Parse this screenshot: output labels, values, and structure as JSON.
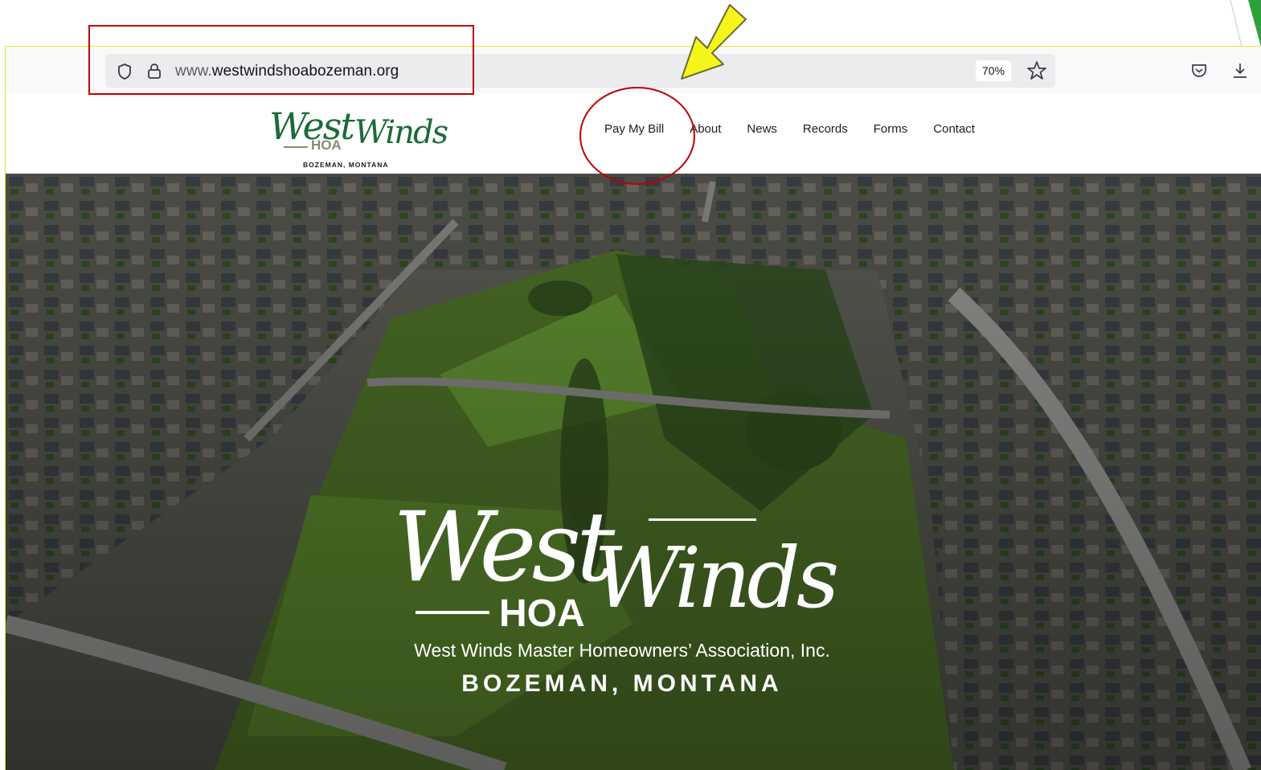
{
  "browser": {
    "url_prefix": "www.",
    "url_domain": "westwindshoabozeman.org",
    "zoom": "70%"
  },
  "site": {
    "logo": {
      "west": "West",
      "winds": "Winds",
      "hoa": "HOA",
      "location": "BOZEMAN, MONTANA"
    },
    "nav": [
      "Pay My Bill",
      "About",
      "News",
      "Records",
      "Forms",
      "Contact"
    ],
    "hero": {
      "west": "West",
      "winds": "Winds",
      "hoa": "HOA",
      "tagline": "West Winds Master Homeowners’ Association, Inc.",
      "location": "BOZEMAN, MONTANA"
    }
  },
  "colors": {
    "logo_green": "#1b6b38",
    "annotation_red": "#c00000",
    "arrow_yellow": "#f5f51b",
    "frame_yellow": "#e9e22f"
  }
}
